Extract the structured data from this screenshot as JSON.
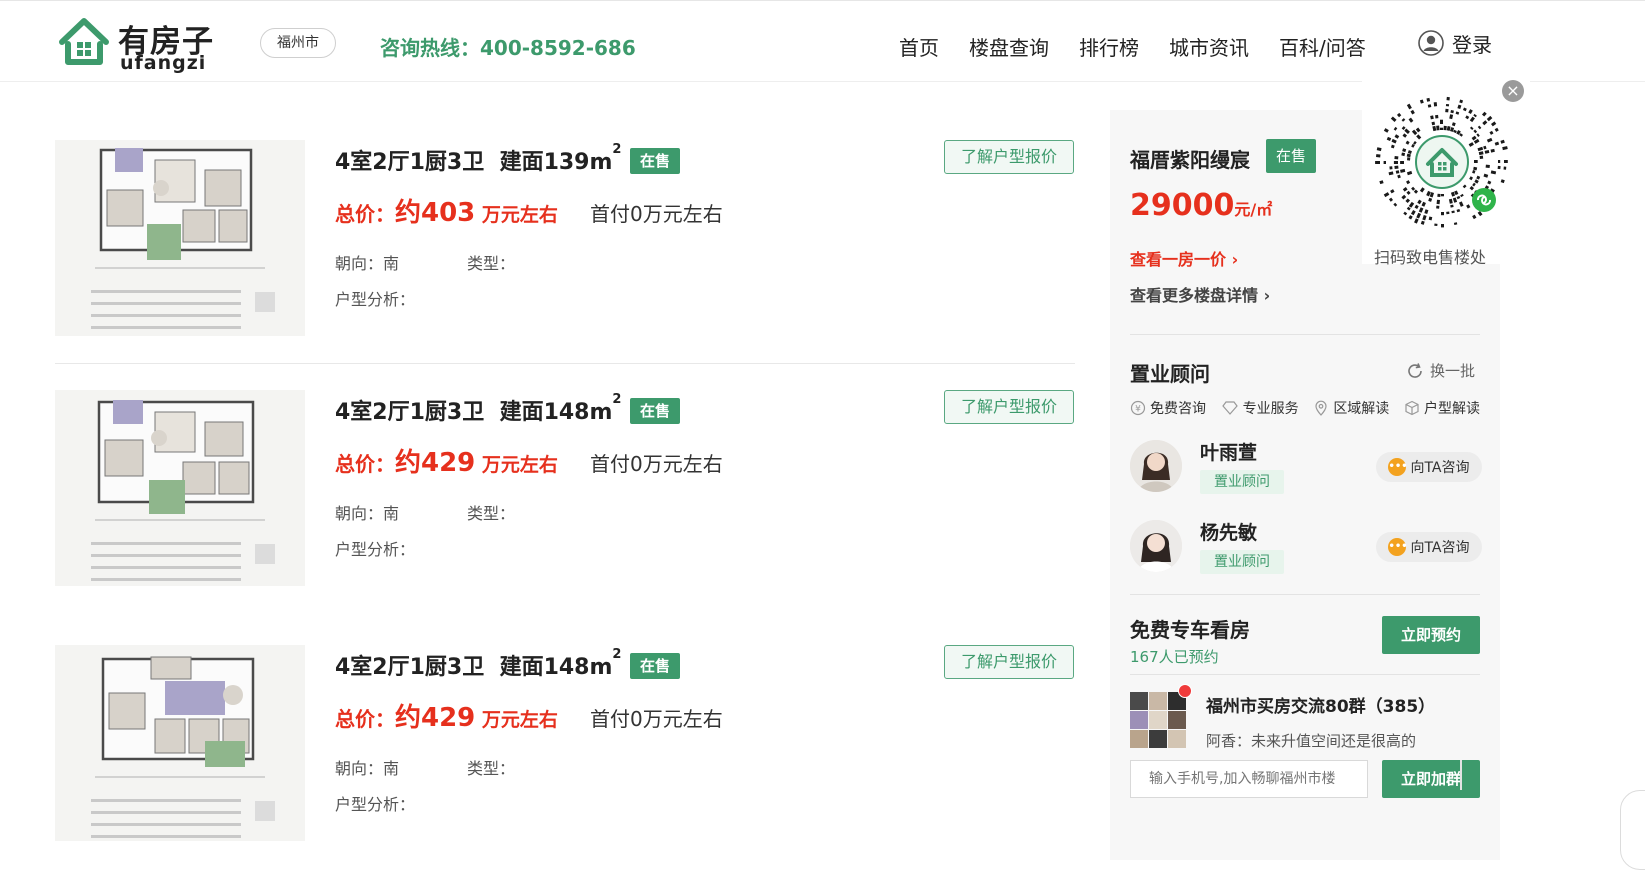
{
  "header": {
    "logo_cn": "有房子",
    "logo_en": "ufangzi",
    "city": "福州市",
    "hotline": "咨询热线：400-8592-686",
    "nav": [
      "首页",
      "楼盘查询",
      "排行榜",
      "城市资讯",
      "百科/问答"
    ],
    "login": "登录"
  },
  "listings": [
    {
      "layout": "4室2厅1厨3卫",
      "area_label": "建面139m",
      "area_sup": "2",
      "status": "在售",
      "quote_button": "了解户型报价",
      "price_label": "总价：",
      "price_value": "约403",
      "price_unit": " 万元左右",
      "down_payment": "首付0万元左右",
      "facing": "朝向：南",
      "type": "类型：",
      "analysis": "户型分析："
    },
    {
      "layout": "4室2厅1厨3卫",
      "area_label": "建面148m",
      "area_sup": "2",
      "status": "在售",
      "quote_button": "了解户型报价",
      "price_label": "总价：",
      "price_value": "约429",
      "price_unit": " 万元左右",
      "down_payment": "首付0万元左右",
      "facing": "朝向：南",
      "type": "类型：",
      "analysis": "户型分析："
    },
    {
      "layout": "4室2厅1厨3卫",
      "area_label": "建面148m",
      "area_sup": "2",
      "status": "在售",
      "quote_button": "了解户型报价",
      "price_label": "总价：",
      "price_value": "约429",
      "price_unit": " 万元左右",
      "down_payment": "首付0万元左右",
      "facing": "朝向：南",
      "type": "类型：",
      "analysis": "户型分析："
    }
  ],
  "project": {
    "name": "福厝紫阳缦宸",
    "status": "在售",
    "price_value": "29000",
    "price_unit": "元/㎡",
    "link_one_price": "查看一房一价",
    "link_more": "查看更多楼盘详情"
  },
  "qr": {
    "caption": "扫码致电售楼处",
    "close": "×"
  },
  "advisors": {
    "title": "置业顾问",
    "refresh": "换一批",
    "features": [
      "免费咨询",
      "专业服务",
      "区域解读",
      "户型解读"
    ],
    "people": [
      {
        "name": "叶雨萱",
        "role": "置业顾问",
        "consult": "向TA咨询"
      },
      {
        "name": "杨先敏",
        "role": "置业顾问",
        "consult": "向TA咨询"
      }
    ]
  },
  "free_car": {
    "title": "免费专车看房",
    "count": "167人已预约",
    "button": "立即预约"
  },
  "group": {
    "title": "福州市买房交流80群（385）",
    "message": "阿香：未来升值空间还是很高的",
    "input_placeholder": "输入手机号,加入畅聊福州市楼",
    "button": "立即加群"
  },
  "colors": {
    "brand_green": "#3d9a6c",
    "price_red": "#e6301d"
  }
}
